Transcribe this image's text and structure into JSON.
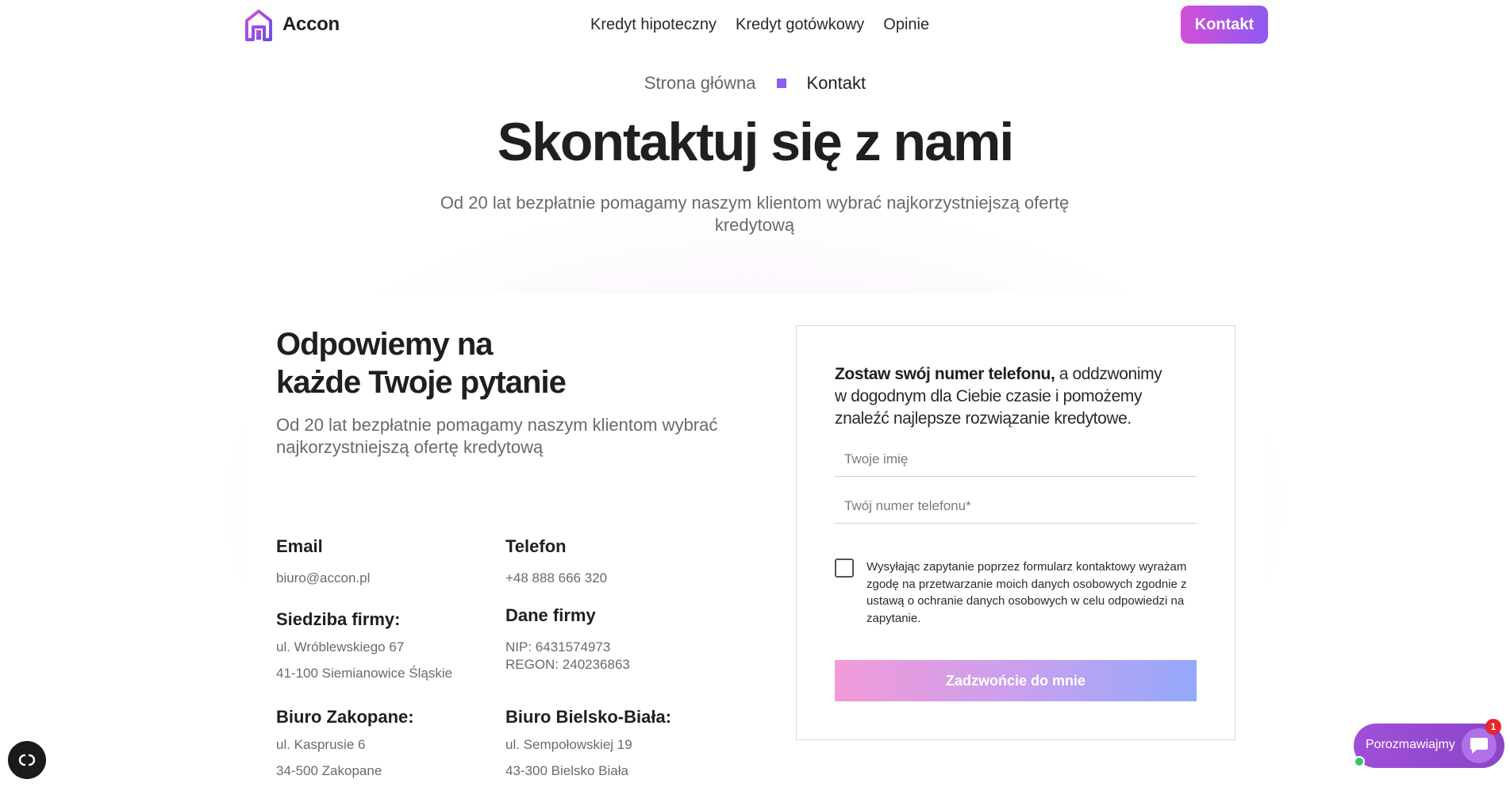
{
  "header": {
    "brand": "Accon",
    "nav": [
      "Kredyt hipoteczny",
      "Kredyt gotówkowy",
      "Opinie"
    ],
    "cta": "Kontakt"
  },
  "breadcrumb": {
    "home": "Strona główna",
    "current": "Kontakt"
  },
  "hero": {
    "title": "Skontaktuj się z nami",
    "subtitle": "Od 20 lat bezpłatnie pomagamy naszym klientom wybrać najkorzystniejszą ofertę kredytową"
  },
  "left": {
    "title_line1": "Odpowiemy na",
    "title_line2": "każde Twoje pytanie",
    "subtitle": "Od 20 lat bezpłatnie pomagamy naszym klientom wybrać najkorzystniejszą ofertę kredytową",
    "email": {
      "label": "Email",
      "value": "biuro@accon.pl"
    },
    "phone": {
      "label": "Telefon",
      "value": "+48 888 666 320"
    },
    "hq": {
      "label": "Siedziba firmy:",
      "line1": "ul. Wróblewskiego 67",
      "line2": "41-100 Siemianowice Śląskie"
    },
    "company": {
      "label": "Dane firmy",
      "line1": "NIP: 6431574973",
      "line2": "REGON: 240236863"
    },
    "zakopane": {
      "label": "Biuro Zakopane:",
      "line1": "ul. Kasprusie 6",
      "line2": "34-500 Zakopane"
    },
    "bielsko": {
      "label": "Biuro Bielsko-Biała:",
      "line1": "ul. Sempołowskiej 19",
      "line2": "43-300 Bielsko Biała"
    }
  },
  "form": {
    "intro_bold": "Zostaw swój numer telefonu,",
    "intro_rest": " a oddzwonimy w dogodnym dla Ciebie czasie i pomożemy znaleźć najlepsze rozwiązanie kredytowe.",
    "name_placeholder": "Twoje imię",
    "phone_placeholder": "Twój numer telefonu*",
    "consent": "Wysyłając zapytanie poprzez formularz kontaktowy wyrażam zgodę na przetwarzanie moich danych osobowych zgodnie z ustawą o ochranie danych osobowych w celu odpowiedzi na zapytanie.",
    "submit": "Zadzwońcie do mnie"
  },
  "chat": {
    "label": "Porozmawiajmy",
    "badge": "1"
  },
  "colors": {
    "accent": "#8e5af0",
    "cta_start": "#d14fd8",
    "cta_end": "#8e5af0",
    "chat": "#9a4ad6"
  }
}
